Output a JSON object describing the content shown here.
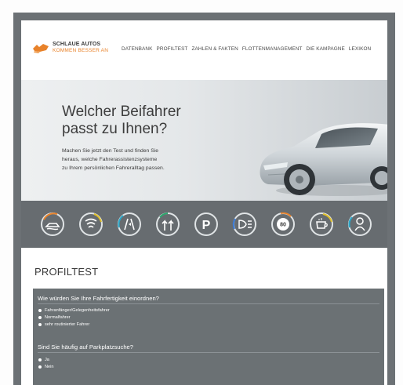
{
  "logo": {
    "line1": "SCHLAUE AUTOS",
    "line2": "KOMMEN BESSER AN",
    "accent_color": "#e8822a"
  },
  "nav": {
    "items": [
      {
        "label": "DATENBANK"
      },
      {
        "label": "PROFILTEST"
      },
      {
        "label": "ZAHLEN & FAKTEN"
      },
      {
        "label": "FLOTTENMANAGEMENT"
      },
      {
        "label": "DIE KAMPAGNE"
      },
      {
        "label": "LEXIKON"
      }
    ]
  },
  "hero": {
    "title_line1": "Welcher Beifahrer",
    "title_line2": "passt zu Ihnen?",
    "text_line1": "Machen Sie jetzt den Test und finden Sie",
    "text_line2": "heraus, welche Fahrerassistenzsysteme",
    "text_line3": "zu Ihrem persönlichen Fahreralltag passen."
  },
  "assist_icons": [
    {
      "name": "car-wave-icon"
    },
    {
      "name": "wifi-signal-icon"
    },
    {
      "name": "lane-assist-icon"
    },
    {
      "name": "road-arrows-icon"
    },
    {
      "name": "parking-icon"
    },
    {
      "name": "headlight-icon"
    },
    {
      "name": "speed-limit-icon",
      "label": "80"
    },
    {
      "name": "coffee-cup-icon"
    },
    {
      "name": "driver-icon"
    }
  ],
  "profiltest": {
    "title": "PROFILTEST",
    "questions": [
      {
        "question": "Wie würden Sie Ihre Fahrfertigkeit einordnen?",
        "options": [
          "Fahranfänger/Gelegenheitsfahrer",
          "Normalfahrer",
          "sehr routinierter Fahrer"
        ]
      },
      {
        "question": "Sind Sie häufig auf Parkplatzsuche?",
        "options": [
          "Ja",
          "Nein"
        ]
      }
    ]
  },
  "colors": {
    "frame": "#6c7175",
    "strip": "#676c70",
    "form_bg": "#6b7174"
  }
}
